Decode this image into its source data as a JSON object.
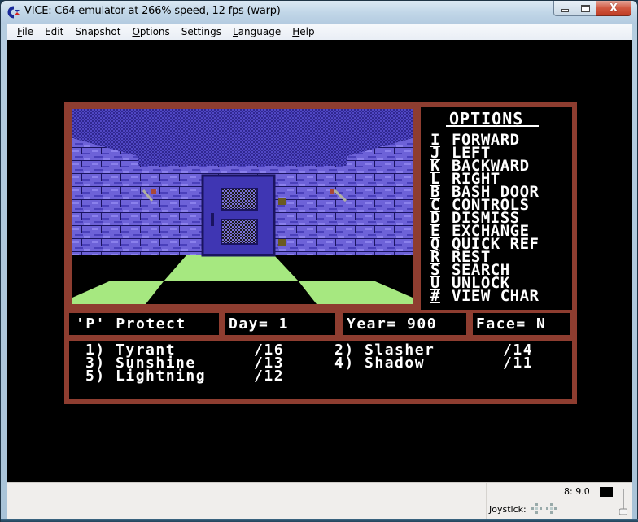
{
  "window": {
    "title": "VICE: C64 emulator at 266% speed, 12 fps (warp)",
    "controls": {
      "minimize": "minimize",
      "maximize": "maximize",
      "close": "X"
    }
  },
  "menu": [
    {
      "label": "File",
      "accel": "F",
      "rest": "ile"
    },
    {
      "label": "Edit",
      "accel": "",
      "rest": "Edit"
    },
    {
      "label": "Snapshot",
      "accel": "",
      "rest": "Snapshot"
    },
    {
      "label": "Options",
      "accel": "O",
      "rest": "ptions"
    },
    {
      "label": "Settings",
      "accel": "",
      "rest": "Settings"
    },
    {
      "label": "Language",
      "accel": "L",
      "rest": "anguage"
    },
    {
      "label": "Help",
      "accel": "H",
      "rest": "elp"
    }
  ],
  "game": {
    "options_title": "OPTIONS",
    "options": [
      {
        "key": "I",
        "label": "FORWARD"
      },
      {
        "key": "J",
        "label": "LEFT"
      },
      {
        "key": "K",
        "label": "BACKWARD"
      },
      {
        "key": "L",
        "label": "RIGHT"
      },
      {
        "key": "B",
        "label": "BASH DOOR"
      },
      {
        "key": "C",
        "label": "CONTROLS"
      },
      {
        "key": "D",
        "label": "DISMISS"
      },
      {
        "key": "E",
        "label": "EXCHANGE"
      },
      {
        "key": "Q",
        "label": "QUICK REF"
      },
      {
        "key": "R",
        "label": "REST"
      },
      {
        "key": "S",
        "label": "SEARCH"
      },
      {
        "key": "U",
        "label": "UNLOCK"
      },
      {
        "key": "#",
        "label": "VIEW CHAR"
      }
    ],
    "status": {
      "protect": "'P' Protect",
      "day": "Day= 1",
      "year": "Year= 900",
      "face": "Face= N"
    },
    "party": [
      {
        "slot": "1)",
        "name": "Tyrant",
        "value": "/16"
      },
      {
        "slot": "2)",
        "name": "Slasher",
        "value": "/14"
      },
      {
        "slot": "3)",
        "name": "Sunshine",
        "value": "/13"
      },
      {
        "slot": "4)",
        "name": "Shadow",
        "value": "/11"
      },
      {
        "slot": "5)",
        "name": "Lightning",
        "value": "/12"
      }
    ],
    "colors": {
      "border": "#8e3d30",
      "wall_light": "#7a6fe0",
      "wall_dark": "#3f36b3",
      "floor": "#a6e880",
      "ceiling": "#3a31a0"
    }
  },
  "statusbar": {
    "speed": "8: 9.0",
    "joystick_label": "Joystick:"
  }
}
